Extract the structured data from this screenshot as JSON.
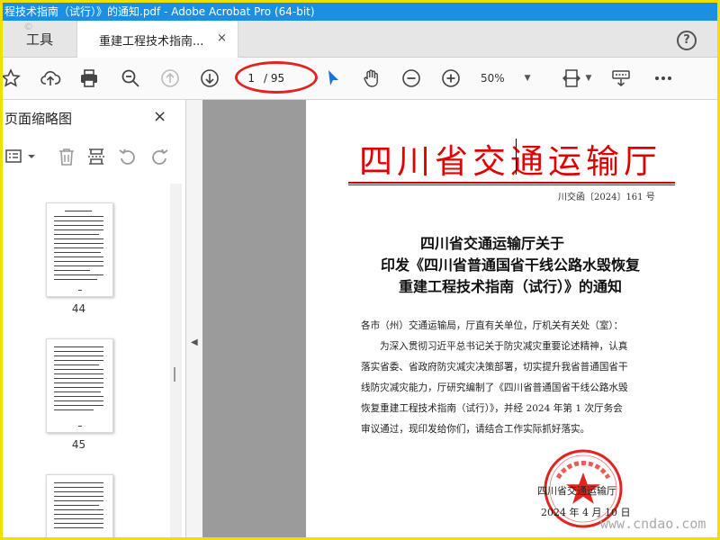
{
  "window": {
    "title": "程技术指南（试行）》的通知.pdf - Adobe Acrobat Pro (64-bit)"
  },
  "tabs": {
    "tools": "工具",
    "document": "重建工程技术指南...",
    "close": "×",
    "help": "?"
  },
  "toolbar": {
    "page_current": "1",
    "page_total": "/ 95",
    "zoom": "50%",
    "highlight_color": "#e0241f"
  },
  "thumbnails": {
    "title": "页面缩略图",
    "close": "×",
    "pages": [
      {
        "label": "44"
      },
      {
        "label": "45"
      }
    ]
  },
  "document": {
    "header": "四川省交通运输厅",
    "number": "川交函〔2024〕161 号",
    "title_lines": [
      "四川省交通运输厅关于",
      "印发《四川省普通国省干线公路水毁恢复",
      "重建工程技术指南（试行）》的通知"
    ],
    "salutation": "各市（州）交通运输局，厅直有关单位，厅机关有关处（室）：",
    "paragraph_lines": [
      "为深入贯彻习近平总书记关于防灾减灾重要论述精神，认真",
      "落实省委、省政府防灾减灾决策部署，切实提升我省普通国省干",
      "线防灾减灾能力，厅研究编制了《四川省普通国省干线公路水毁",
      "恢复重建工程技术指南（试行）》，并经 2024 年第 1 次厅务会",
      "审议通过，现印发给你们，请结合工作实际抓好落实。"
    ],
    "signature": "四川省交通运输厅",
    "date": "2024 年 4 月 10 日",
    "header_color": "#e00000"
  },
  "watermark": {
    "site": "www.cndao.com"
  }
}
